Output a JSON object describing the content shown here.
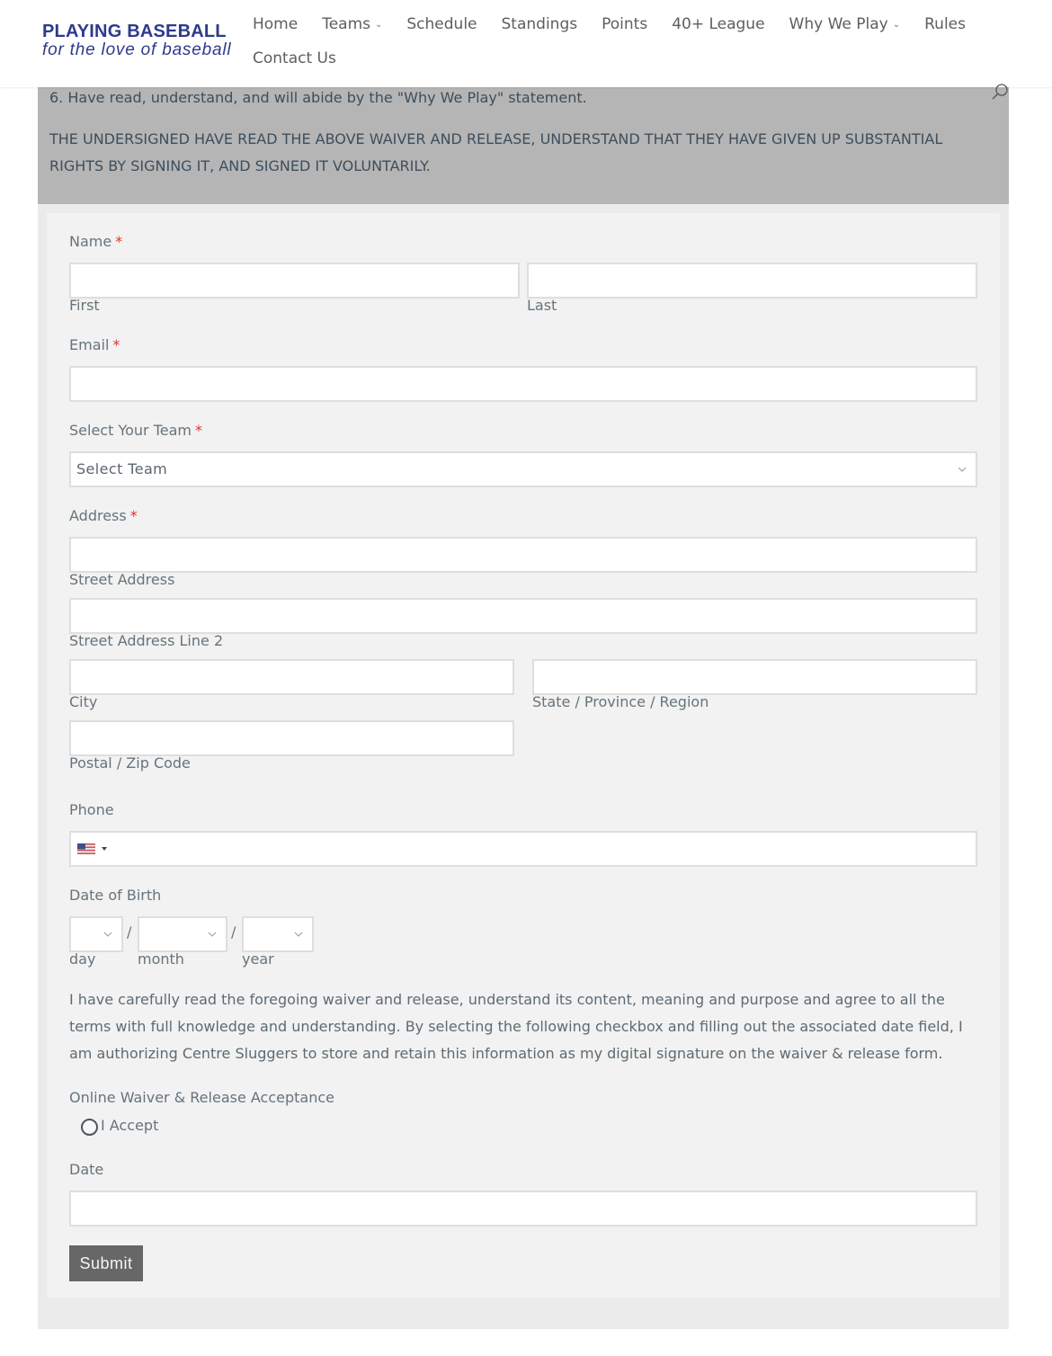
{
  "header": {
    "logo_title": "PLAYING BASEBALL",
    "logo_tagline": "for the love of baseball",
    "nav": [
      {
        "label": "Home",
        "has_dropdown": false
      },
      {
        "label": "Teams",
        "has_dropdown": true
      },
      {
        "label": "Schedule",
        "has_dropdown": false
      },
      {
        "label": "Standings",
        "has_dropdown": false
      },
      {
        "label": "Points",
        "has_dropdown": false
      },
      {
        "label": "40+ League",
        "has_dropdown": false
      },
      {
        "label": "Why We Play",
        "has_dropdown": true
      },
      {
        "label": "Rules",
        "has_dropdown": false
      },
      {
        "label": "Contact Us",
        "has_dropdown": false
      }
    ],
    "search_icon": "search-icon"
  },
  "waiver": {
    "item6": "6. Have read, understand, and will abide by the \"Why We Play\" statement.",
    "closing": "THE UNDERSIGNED HAVE READ THE ABOVE WAIVER AND RELEASE, UNDERSTAND THAT THEY HAVE GIVEN UP SUBSTANTIAL RIGHTS BY SIGNING IT, AND SIGNED IT VOLUNTARILY."
  },
  "form": {
    "required_marker": "*",
    "name": {
      "label": "Name",
      "first_label": "First",
      "last_label": "Last",
      "first_value": "",
      "last_value": ""
    },
    "email": {
      "label": "Email",
      "value": ""
    },
    "team": {
      "label": "Select Your Team",
      "selected": "Select Team"
    },
    "address": {
      "label": "Address",
      "street_label": "Street Address",
      "street2_label": "Street Address Line 2",
      "city_label": "City",
      "state_label": "State / Province / Region",
      "zip_label": "Postal / Zip Code"
    },
    "phone": {
      "label": "Phone",
      "country": "US",
      "value": ""
    },
    "dob": {
      "label": "Date of Birth",
      "separator": "/",
      "day_label": "day",
      "month_label": "month",
      "year_label": "year",
      "day": "",
      "month": "",
      "year": ""
    },
    "consent_text": "I have carefully read the foregoing waiver and release, understand its content, meaning and purpose and agree to all the terms with full knowledge and understanding. By selecting the following checkbox and filling out the associated date field, I am authorizing Centre Sluggers to store and retain this information as my digital signature on the waiver & release form.",
    "acceptance": {
      "label": "Online Waiver & Release Acceptance",
      "option": "I Accept",
      "checked": false
    },
    "date": {
      "label": "Date",
      "value": ""
    },
    "submit_label": "Submit"
  },
  "colors": {
    "brand": "#2e3a8c",
    "required": "#e0312b",
    "waiver_bg": "#b5b5b5",
    "form_bg": "#f2f2f2",
    "submit_bg": "#676767"
  }
}
